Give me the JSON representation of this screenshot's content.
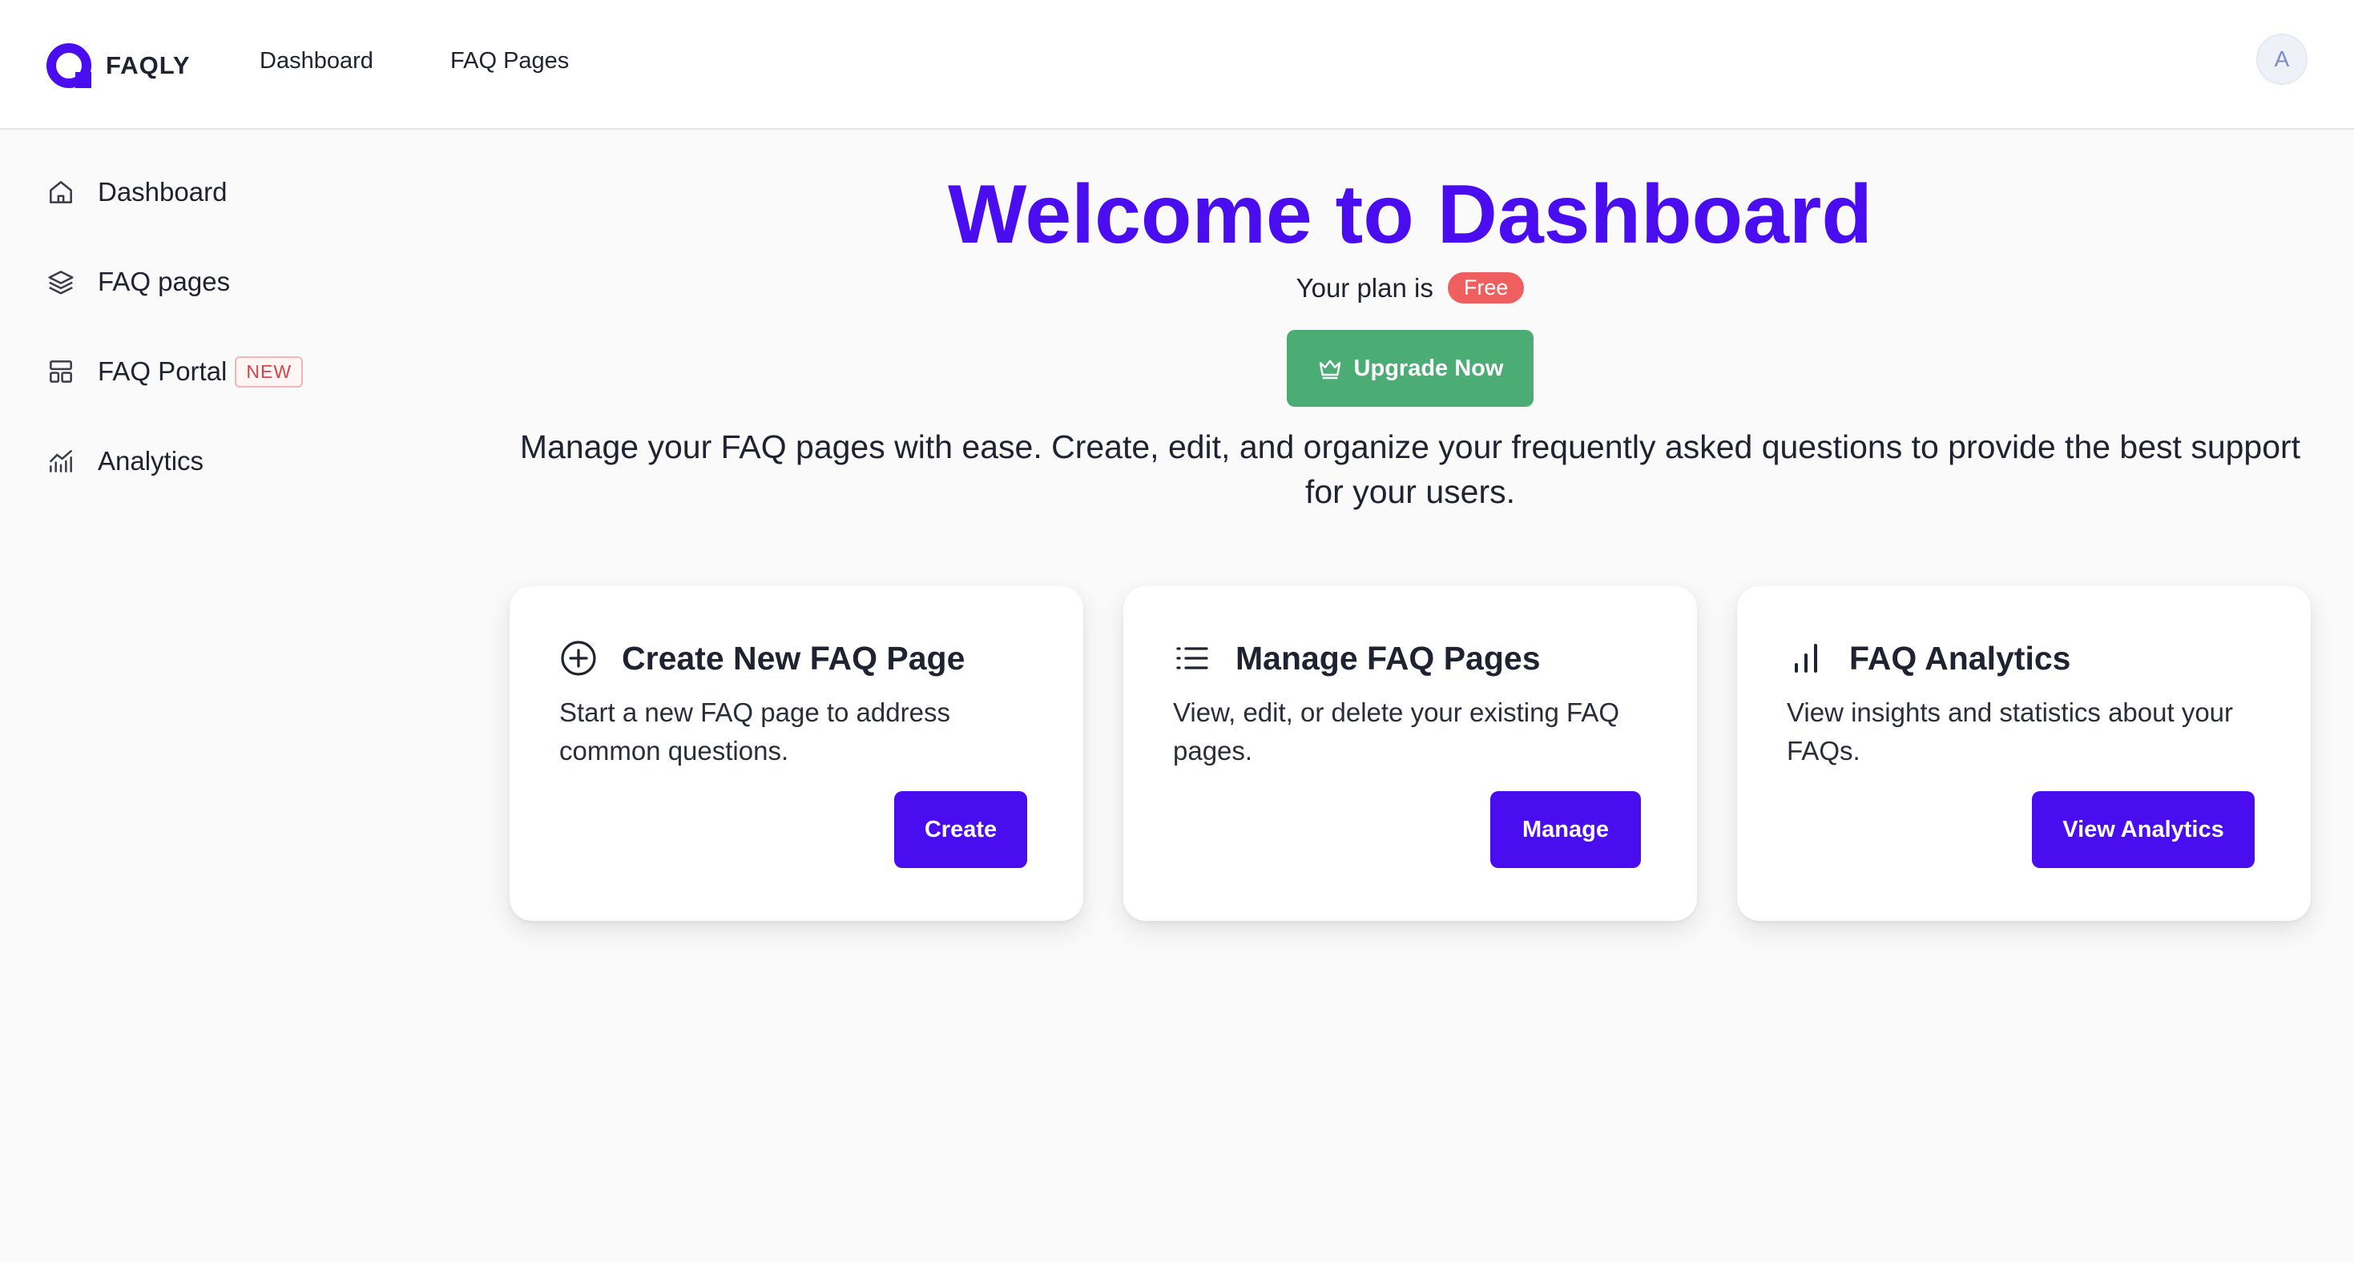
{
  "app": {
    "name": "FAQLY",
    "brand_color": "#4a0df0"
  },
  "topnav": {
    "items": [
      {
        "label": "Dashboard"
      },
      {
        "label": "FAQ Pages"
      }
    ]
  },
  "user": {
    "avatar_initial": "A"
  },
  "sidebar": {
    "items": [
      {
        "label": "Dashboard",
        "icon": "home-icon"
      },
      {
        "label": "FAQ pages",
        "icon": "layers-icon"
      },
      {
        "label": "FAQ Portal",
        "icon": "layout-icon",
        "badge": "NEW"
      },
      {
        "label": "Analytics",
        "icon": "chart-line-icon"
      }
    ]
  },
  "main": {
    "title": "Welcome to Dashboard",
    "plan_prefix": "Your plan is",
    "plan_name": "Free",
    "upgrade_label": "Upgrade Now",
    "description": "Manage your FAQ pages with ease. Create, edit, and organize your frequently asked questions to provide the best support for your users."
  },
  "cards": [
    {
      "icon": "plus-circle-icon",
      "title": "Create New FAQ Page",
      "text": "Start a new FAQ page to address common questions.",
      "button": "Create"
    },
    {
      "icon": "list-icon",
      "title": "Manage FAQ Pages",
      "text": "View, edit, or delete your existing FAQ pages.",
      "button": "Manage"
    },
    {
      "icon": "bar-chart-icon",
      "title": "FAQ Analytics",
      "text": "View insights and statistics about your FAQs.",
      "button": "View Analytics"
    }
  ],
  "colors": {
    "upgrade": "#4bac74",
    "plan_badge": "#ef5f5f",
    "new_badge": "#d64545"
  }
}
